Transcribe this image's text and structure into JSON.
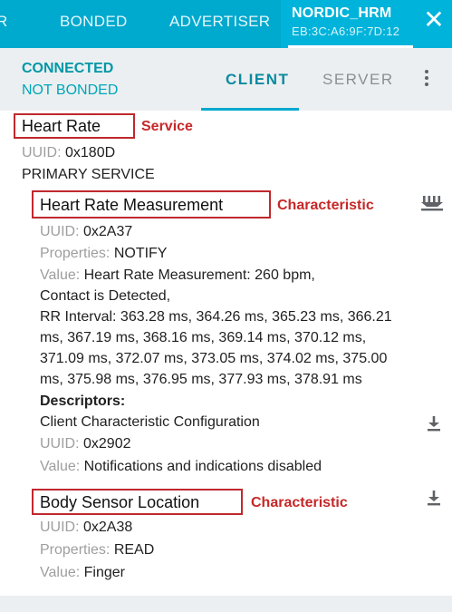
{
  "top_tabs": {
    "partial_left": "R",
    "bonded": "BONDED",
    "advertiser": "ADVERTISER",
    "device_name": "NORDIC_HRM",
    "device_address": "EB:3C:A6:9F:7D:12"
  },
  "status": {
    "connected": "CONNECTED",
    "bond_state": "NOT BONDED",
    "client_tab": "CLIENT",
    "server_tab": "SERVER"
  },
  "service": {
    "name": "Heart Rate",
    "annotation": "Service",
    "uuid_label": "UUID: ",
    "uuid": "0x180D",
    "type": "PRIMARY SERVICE"
  },
  "characteristics": [
    {
      "name": "Heart Rate Measurement",
      "annotation": "Characteristic",
      "uuid_label": "UUID: ",
      "uuid": "0x2A37",
      "properties_label": "Properties: ",
      "properties": "NOTIFY",
      "value_label": "Value: ",
      "value_lines": [
        "Heart Rate Measurement: 260 bpm,",
        "Contact is Detected,",
        "RR Interval: 363.28 ms, 364.26 ms, 365.23 ms, 366.21",
        "ms, 367.19 ms, 368.16 ms, 369.14 ms, 370.12 ms,",
        "371.09 ms, 372.07 ms, 373.05 ms, 374.02 ms, 375.00",
        "ms, 375.98 ms, 376.95 ms, 377.93 ms, 378.91 ms"
      ],
      "descriptors_label": "Descriptors:",
      "descriptor": {
        "name": "Client Characteristic Configuration",
        "uuid_label": "UUID: ",
        "uuid": "0x2902",
        "value_label": "Value: ",
        "value": "Notifications and indications disabled"
      }
    },
    {
      "name": "Body Sensor Location",
      "annotation": "Characteristic",
      "uuid_label": "UUID: ",
      "uuid": "0x2A38",
      "properties_label": "Properties: ",
      "properties": "READ",
      "value_label": "Value: ",
      "value": "Finger"
    }
  ],
  "icons": {
    "close": "close-icon",
    "more": "more-vert-icon",
    "notify": "notify-arrows-icon",
    "read": "download-arrow-icon"
  },
  "colors": {
    "accent": "#00a9ce",
    "annotation": "#c62828",
    "status_green": "#0097a7"
  }
}
